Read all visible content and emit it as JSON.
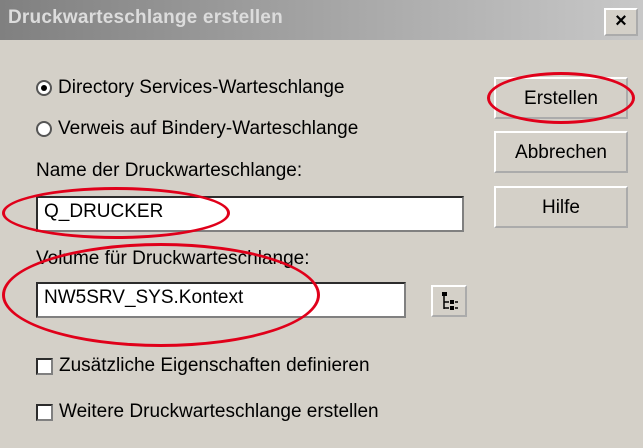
{
  "window": {
    "title": "Druckwarteschlange erstellen",
    "close_label": "×"
  },
  "options": {
    "radio1_label": "Directory Services-Warteschlange",
    "radio1_selected": true,
    "radio2_label": "Verweis auf Bindery-Warteschlange",
    "radio2_selected": false
  },
  "fields": {
    "name_label": "Name der Druckwarteschlange:",
    "name_value": "Q_DRUCKER",
    "volume_label": "Volume für Druckwarteschlange:",
    "volume_value": "NW5SRV_SYS.Kontext"
  },
  "checkboxes": {
    "additional_props_label": "Zusätzliche Eigenschaften definieren",
    "additional_props_checked": false,
    "more_queues_label": "Weitere Druckwarteschlange erstellen",
    "more_queues_checked": false
  },
  "buttons": {
    "create_label": "Erstellen",
    "cancel_label": "Abbrechen",
    "help_label": "Hilfe"
  },
  "colors": {
    "dialog_bg": "#d4d0c8",
    "highlight_ellipse": "#e0001a"
  },
  "icons": {
    "browse": "tree-browse-icon",
    "close": "close-icon"
  }
}
